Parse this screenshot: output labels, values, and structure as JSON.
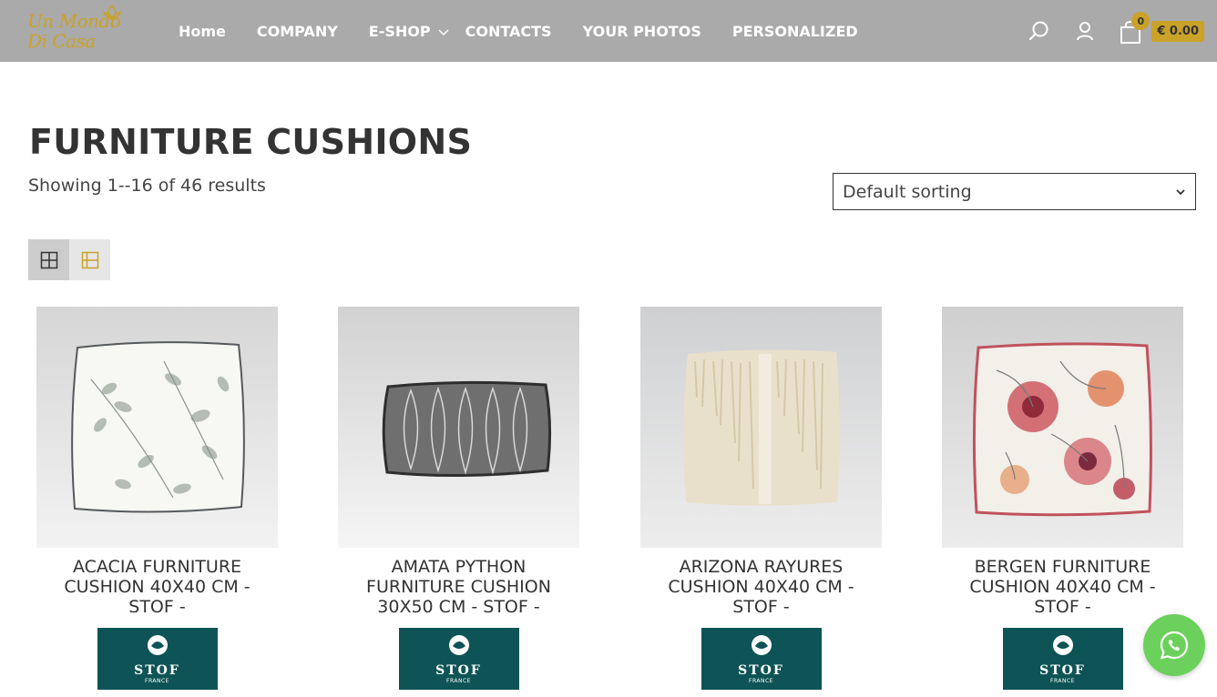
{
  "header": {
    "logo_line1": "Un Mondo",
    "logo_line2": "Di Casa",
    "nav": [
      {
        "label": "Home"
      },
      {
        "label": "COMPANY"
      },
      {
        "label": "E-SHOP"
      },
      {
        "label": "CONTACTS"
      },
      {
        "label": "YOUR PHOTOS"
      },
      {
        "label": "PERSONALIZED"
      }
    ],
    "cart_count": "0",
    "cart_total": "€ 0.00"
  },
  "page": {
    "title": "FURNITURE CUSHIONS",
    "results": "Showing 1--16 of 46 results",
    "sort_selected": "Default sorting"
  },
  "products": [
    {
      "name": "ACACIA FURNITURE CUSHION 40X40 CM - STOF -",
      "brand": "STOF",
      "brand_sub": "FRANCE"
    },
    {
      "name": "AMATA PYTHON FURNITURE CUSHION 30X50 CM - STOF -",
      "brand": "STOF",
      "brand_sub": "FRANCE"
    },
    {
      "name": "ARIZONA RAYURES CUSHION 40X40 CM - STOF -",
      "brand": "STOF",
      "brand_sub": "FRANCE"
    },
    {
      "name": "BERGEN FURNITURE CUSHION 40X40 CM - STOF -",
      "brand": "STOF",
      "brand_sub": "FRANCE"
    }
  ],
  "colors": {
    "header_bg": "#aaaaaa",
    "accent_gold": "#c9a227",
    "brand_teal": "#0e5456",
    "whatsapp_green": "#6cd15c"
  },
  "icons": {
    "search": "search-icon",
    "account": "user-icon",
    "cart": "shopping-bag-icon",
    "grid_view": "grid-view-icon",
    "list_view": "list-view-icon",
    "whatsapp": "whatsapp-icon"
  }
}
